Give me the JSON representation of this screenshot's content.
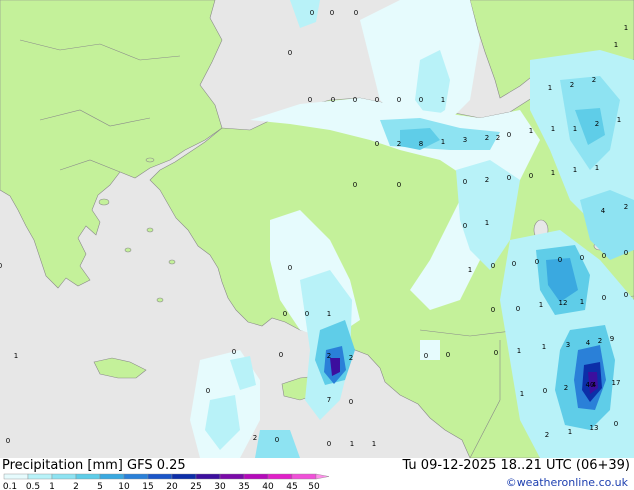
{
  "header": {
    "title": "Precipitation [mm]  GFS 0.25",
    "timestamp": "Tu 09-12-2025 18..21 UTC (06+39)",
    "credit": "©weatheronline.co.uk"
  },
  "colors": {
    "sea": "#e7e7e7",
    "land": "#c4f19a",
    "border": "#8a8a8a",
    "precip": [
      "#e6fbfd",
      "#b8f2f8",
      "#8ee3f2",
      "#5fcde8",
      "#3aa9e0",
      "#2a80d8",
      "#1a55c8",
      "#0c2ea8",
      "#3c0f9e",
      "#7a0aa8",
      "#b40aba",
      "#e020c8",
      "#f050d8",
      "#ff90ea"
    ]
  },
  "legend": {
    "labels": [
      "0.1",
      "0.5",
      "1",
      "2",
      "5",
      "10",
      "15",
      "20",
      "25",
      "30",
      "35",
      "40",
      "45",
      "50"
    ]
  },
  "map_values": [
    {
      "id": "v1",
      "text": "0"
    },
    {
      "id": "v2",
      "text": "0"
    },
    {
      "id": "v3",
      "text": "0"
    },
    {
      "id": "v4",
      "text": "0"
    },
    {
      "id": "v5",
      "text": "0"
    },
    {
      "id": "v6",
      "text": "0"
    },
    {
      "id": "v7",
      "text": "0"
    },
    {
      "id": "v8",
      "text": "0"
    },
    {
      "id": "v9",
      "text": "0"
    },
    {
      "id": "v10",
      "text": "0"
    },
    {
      "id": "v11",
      "text": "0"
    },
    {
      "id": "v12",
      "text": "1"
    },
    {
      "id": "v13",
      "text": "0"
    },
    {
      "id": "v14",
      "text": "2"
    },
    {
      "id": "v15",
      "text": "8"
    },
    {
      "id": "v16",
      "text": "1"
    },
    {
      "id": "v17",
      "text": "3"
    },
    {
      "id": "v18",
      "text": "2"
    },
    {
      "id": "v19",
      "text": "0"
    },
    {
      "id": "v20",
      "text": "1"
    },
    {
      "id": "v21",
      "text": "1"
    },
    {
      "id": "v22",
      "text": "1"
    },
    {
      "id": "v23",
      "text": "2"
    },
    {
      "id": "v24",
      "text": "1"
    },
    {
      "id": "v25",
      "text": "2"
    },
    {
      "id": "v26",
      "text": "2"
    },
    {
      "id": "v27",
      "text": "1"
    },
    {
      "id": "v28",
      "text": "1"
    },
    {
      "id": "v29",
      "text": "1"
    },
    {
      "id": "v30",
      "text": "0"
    },
    {
      "id": "v31",
      "text": "0"
    },
    {
      "id": "v32",
      "text": "0"
    },
    {
      "id": "v33",
      "text": "2"
    },
    {
      "id": "v34",
      "text": "0"
    },
    {
      "id": "v35",
      "text": "0"
    },
    {
      "id": "v36",
      "text": "1"
    },
    {
      "id": "v37",
      "text": "1"
    },
    {
      "id": "v38",
      "text": "4"
    },
    {
      "id": "v39",
      "text": "2"
    },
    {
      "id": "v40",
      "text": "0"
    },
    {
      "id": "v41",
      "text": "1"
    },
    {
      "id": "v42",
      "text": "1"
    },
    {
      "id": "v43",
      "text": "0"
    },
    {
      "id": "v44",
      "text": "0"
    },
    {
      "id": "v45",
      "text": "0"
    },
    {
      "id": "v46",
      "text": "0"
    },
    {
      "id": "v47",
      "text": "1"
    },
    {
      "id": "v48",
      "text": "0"
    },
    {
      "id": "v49",
      "text": "0"
    },
    {
      "id": "v50",
      "text": "0"
    },
    {
      "id": "v51",
      "text": "1"
    },
    {
      "id": "v52",
      "text": "0"
    },
    {
      "id": "v53",
      "text": "12"
    },
    {
      "id": "v54",
      "text": "1"
    },
    {
      "id": "v55",
      "text": "0"
    },
    {
      "id": "v56",
      "text": "0"
    },
    {
      "id": "v57",
      "text": "0"
    },
    {
      "id": "v58",
      "text": "1"
    },
    {
      "id": "v59",
      "text": "0"
    },
    {
      "id": "v60",
      "text": "0"
    },
    {
      "id": "v61",
      "text": "0"
    },
    {
      "id": "v62",
      "text": "0"
    },
    {
      "id": "v63",
      "text": "1"
    },
    {
      "id": "v64",
      "text": "2"
    },
    {
      "id": "v65",
      "text": "3"
    },
    {
      "id": "v66",
      "text": "2"
    },
    {
      "id": "v67",
      "text": "2"
    },
    {
      "id": "v68",
      "text": "7"
    },
    {
      "id": "v69",
      "text": "0"
    },
    {
      "id": "v70",
      "text": "0"
    },
    {
      "id": "v71",
      "text": "0"
    },
    {
      "id": "v72",
      "text": "0"
    },
    {
      "id": "v73",
      "text": "1"
    },
    {
      "id": "v74",
      "text": "1"
    },
    {
      "id": "v75",
      "text": "0"
    },
    {
      "id": "v76",
      "text": "1"
    },
    {
      "id": "v77",
      "text": "2"
    },
    {
      "id": "v78",
      "text": "40"
    },
    {
      "id": "v79",
      "text": "4"
    },
    {
      "id": "v80",
      "text": "17"
    },
    {
      "id": "v81",
      "text": "9"
    },
    {
      "id": "v82",
      "text": "4"
    },
    {
      "id": "v83",
      "text": "13"
    },
    {
      "id": "v84",
      "text": "1"
    },
    {
      "id": "v85",
      "text": "0"
    },
    {
      "id": "v86",
      "text": "2"
    },
    {
      "id": "v87",
      "text": "0"
    },
    {
      "id": "v88",
      "text": "2"
    },
    {
      "id": "v89",
      "text": "1"
    },
    {
      "id": "v90",
      "text": "1"
    },
    {
      "id": "v91",
      "text": "0"
    },
    {
      "id": "v92",
      "text": "2"
    },
    {
      "id": "v93",
      "text": "0"
    },
    {
      "id": "v94",
      "text": "0"
    },
    {
      "id": "v95",
      "text": "0"
    }
  ]
}
